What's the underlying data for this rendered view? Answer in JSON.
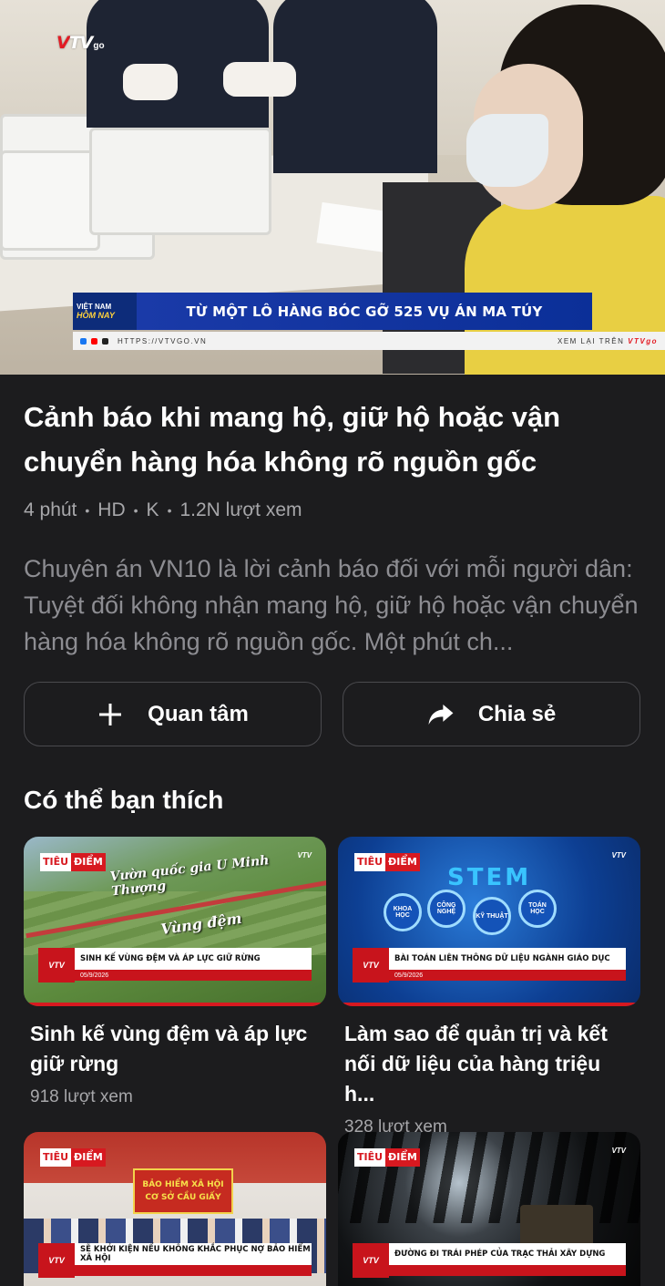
{
  "hero": {
    "channel_logo": "VTV",
    "channel_logo_suffix": "go",
    "show_brand_line1": "VIỆT NAM",
    "show_brand_line2": "HÔM NAY",
    "headline": "TỪ MỘT LÔ HÀNG BÓC GỠ 525 VỤ ÁN MA TÚY",
    "ticker_url": "HTTPS://VTVGO.VN",
    "ticker_replay": "XEM LẠI TRÊN",
    "ticker_replay_brand": "VTVgo"
  },
  "video": {
    "title": "Cảnh báo khi mang hộ, giữ hộ hoặc vận chuyển hàng hóa không rõ nguồn gốc",
    "meta": {
      "duration": "4 phút",
      "quality": "HD",
      "rating": "K",
      "views": "1.2N lượt xem"
    },
    "description": "Chuyên án VN10 là lời cảnh báo đối với mỗi người dân: Tuyệt đối không nhận mang hộ, giữ hộ hoặc vận chuyển hàng hóa không rõ nguồn gốc. Một phút ch..."
  },
  "actions": {
    "follow_label": "Quan tâm",
    "share_label": "Chia sẻ"
  },
  "suggestions": {
    "title": "Có thể bạn thích",
    "items": [
      {
        "tag_a": "TIÊU",
        "tag_b": "ĐIỂM",
        "thumb_sign1": "Vườn quốc gia U Minh Thượng",
        "thumb_sign2": "Vùng đệm",
        "thumb_caption": "SINH KẾ VÙNG ĐỆM VÀ ÁP LỰC GIỮ RỪNG",
        "thumb_date": "05/9/2026",
        "title": "Sinh kế vùng đệm và áp lực giữ rừng",
        "views": "918 lượt xem"
      },
      {
        "tag_a": "TIÊU",
        "tag_b": "ĐIỂM",
        "thumb_stem": "STEM",
        "thumb_bubbles": [
          "KHOA HỌC",
          "CÔNG NGHỆ",
          "KỸ THUẬT",
          "TOÁN HỌC"
        ],
        "thumb_caption": "BÀI TOÁN LIÊN THÔNG DỮ LIỆU NGÀNH GIÁO DỤC",
        "thumb_date": "05/9/2026",
        "title": "Làm sao để quản trị và kết nối dữ liệu của hàng triệu h...",
        "views": "328 lượt xem"
      },
      {
        "tag_a": "TIÊU",
        "tag_b": "ĐIỂM",
        "thumb_banner": "BẢO HIỂM XÃ HỘI CƠ SỞ CẦU GIẤY",
        "thumb_caption": "SẼ KHỞI KIỆN NẾU KHÔNG KHẮC PHỤC NỢ BẢO HIỂM XÃ HỘI"
      },
      {
        "tag_a": "TIÊU",
        "tag_b": "ĐIỂM",
        "thumb_caption": "ĐƯỜNG ĐI TRÁI PHÉP CỦA TRẠC THẢI XÂY DỰNG"
      }
    ]
  },
  "colors": {
    "background": "#1c1c1e",
    "accent_red": "#d71920",
    "text_secondary": "#a7a7aa"
  }
}
